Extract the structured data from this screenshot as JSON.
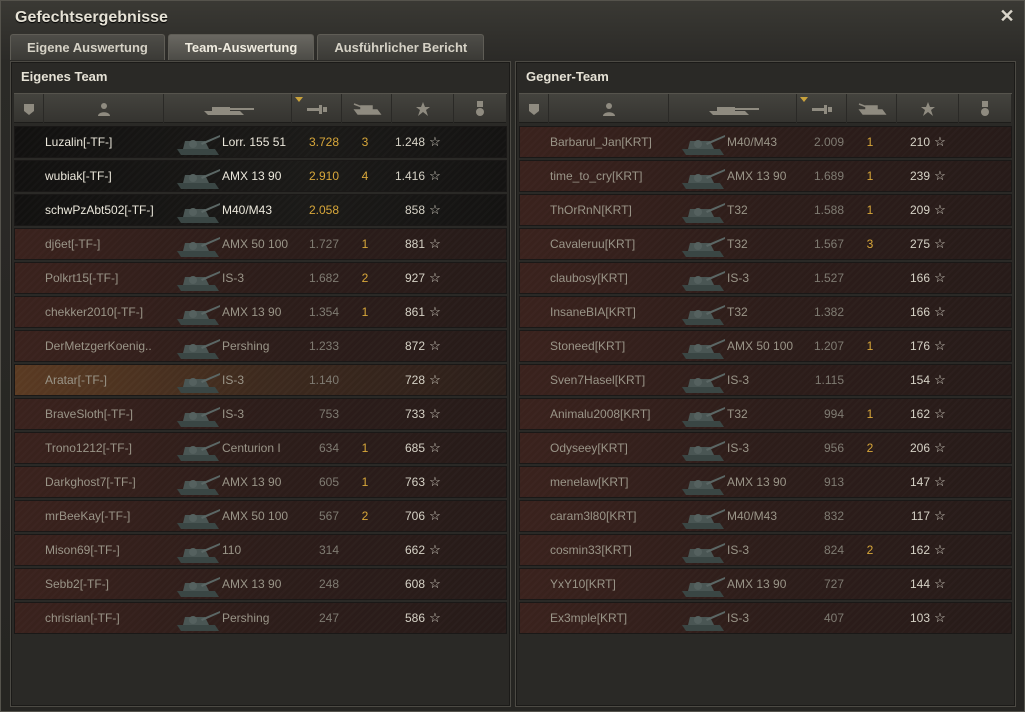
{
  "window": {
    "title": "Gefechtsergebnisse",
    "close_icon": "close-icon"
  },
  "tabs": [
    {
      "label": "Eigene Auswertung",
      "active": false
    },
    {
      "label": "Team-Auswertung",
      "active": true
    },
    {
      "label": "Ausführlicher Bericht",
      "active": false
    }
  ],
  "header_icons": [
    "rank-badge-icon",
    "player-icon",
    "tank-icon",
    "damage-icon",
    "kills-icon",
    "xp-star-icon",
    "medal-icon"
  ],
  "colors": {
    "alive_text": "#ece8dc",
    "dead_text": "#9a9588",
    "damage_alive": "#d8a73a",
    "kills": "#d8a73a"
  },
  "own_team": {
    "title": "Eigenes Team",
    "rows": [
      {
        "name": "Luzalin[-TF-]",
        "tank": "Lorr. 155 51",
        "damage": "3.728",
        "kills": "3",
        "xp": "1.248",
        "state": "alive"
      },
      {
        "name": "wubiak[-TF-]",
        "tank": "AMX 13 90",
        "damage": "2.910",
        "kills": "4",
        "xp": "1.416",
        "state": "alive"
      },
      {
        "name": "schwPzAbt502[-TF-]",
        "tank": "M40/M43",
        "damage": "2.058",
        "kills": "",
        "xp": "858",
        "state": "alive"
      },
      {
        "name": "dj6et[-TF-]",
        "tank": "AMX 50 100",
        "damage": "1.727",
        "kills": "1",
        "xp": "881",
        "state": "dead"
      },
      {
        "name": "Polkrt15[-TF-]",
        "tank": "IS-3",
        "damage": "1.682",
        "kills": "2",
        "xp": "927",
        "state": "dead"
      },
      {
        "name": "chekker2010[-TF-]",
        "tank": "AMX 13 90",
        "damage": "1.354",
        "kills": "1",
        "xp": "861",
        "state": "dead"
      },
      {
        "name": "DerMetzgerKoenig..",
        "tank": "Pershing",
        "damage": "1.233",
        "kills": "",
        "xp": "872",
        "state": "dead"
      },
      {
        "name": "Aratar[-TF-]",
        "tank": "IS-3",
        "damage": "1.140",
        "kills": "",
        "xp": "728",
        "state": "self"
      },
      {
        "name": "BraveSloth[-TF-]",
        "tank": "IS-3",
        "damage": "753",
        "kills": "",
        "xp": "733",
        "state": "dead"
      },
      {
        "name": "Trono1212[-TF-]",
        "tank": "Centurion I",
        "damage": "634",
        "kills": "1",
        "xp": "685",
        "state": "dead"
      },
      {
        "name": "Darkghost7[-TF-]",
        "tank": "AMX 13 90",
        "damage": "605",
        "kills": "1",
        "xp": "763",
        "state": "dead"
      },
      {
        "name": "mrBeeKay[-TF-]",
        "tank": "AMX 50 100",
        "damage": "567",
        "kills": "2",
        "xp": "706",
        "state": "dead"
      },
      {
        "name": "Mison69[-TF-]",
        "tank": "110",
        "damage": "314",
        "kills": "",
        "xp": "662",
        "state": "dead"
      },
      {
        "name": "Sebb2[-TF-]",
        "tank": "AMX 13 90",
        "damage": "248",
        "kills": "",
        "xp": "608",
        "state": "dead"
      },
      {
        "name": "chrisrian[-TF-]",
        "tank": "Pershing",
        "damage": "247",
        "kills": "",
        "xp": "586",
        "state": "dead"
      }
    ]
  },
  "enemy_team": {
    "title": "Gegner-Team",
    "rows": [
      {
        "name": "Barbarul_Jan[KRT]",
        "tank": "M40/M43",
        "damage": "2.009",
        "kills": "1",
        "xp": "210",
        "state": "dead"
      },
      {
        "name": "time_to_cry[KRT]",
        "tank": "AMX 13 90",
        "damage": "1.689",
        "kills": "1",
        "xp": "239",
        "state": "dead"
      },
      {
        "name": "ThOrRnN[KRT]",
        "tank": "T32",
        "damage": "1.588",
        "kills": "1",
        "xp": "209",
        "state": "dead"
      },
      {
        "name": "Cavaleruu[KRT]",
        "tank": "T32",
        "damage": "1.567",
        "kills": "3",
        "xp": "275",
        "state": "dead"
      },
      {
        "name": "claubosy[KRT]",
        "tank": "IS-3",
        "damage": "1.527",
        "kills": "",
        "xp": "166",
        "state": "dead"
      },
      {
        "name": "InsaneBIA[KRT]",
        "tank": "T32",
        "damage": "1.382",
        "kills": "",
        "xp": "166",
        "state": "dead"
      },
      {
        "name": "Stoneed[KRT]",
        "tank": "AMX 50 100",
        "damage": "1.207",
        "kills": "1",
        "xp": "176",
        "state": "dead"
      },
      {
        "name": "Sven7Hasel[KRT]",
        "tank": "IS-3",
        "damage": "1.115",
        "kills": "",
        "xp": "154",
        "state": "dead"
      },
      {
        "name": "Animalu2008[KRT]",
        "tank": "T32",
        "damage": "994",
        "kills": "1",
        "xp": "162",
        "state": "dead"
      },
      {
        "name": "Odyseey[KRT]",
        "tank": "IS-3",
        "damage": "956",
        "kills": "2",
        "xp": "206",
        "state": "dead"
      },
      {
        "name": "menelaw[KRT]",
        "tank": "AMX 13 90",
        "damage": "913",
        "kills": "",
        "xp": "147",
        "state": "dead"
      },
      {
        "name": "caram3l80[KRT]",
        "tank": "M40/M43",
        "damage": "832",
        "kills": "",
        "xp": "117",
        "state": "dead"
      },
      {
        "name": "cosmin33[KRT]",
        "tank": "IS-3",
        "damage": "824",
        "kills": "2",
        "xp": "162",
        "state": "dead"
      },
      {
        "name": "YxY10[KRT]",
        "tank": "AMX 13 90",
        "damage": "727",
        "kills": "",
        "xp": "144",
        "state": "dead"
      },
      {
        "name": "Ex3mple[KRT]",
        "tank": "IS-3",
        "damage": "407",
        "kills": "",
        "xp": "103",
        "state": "dead"
      }
    ]
  }
}
